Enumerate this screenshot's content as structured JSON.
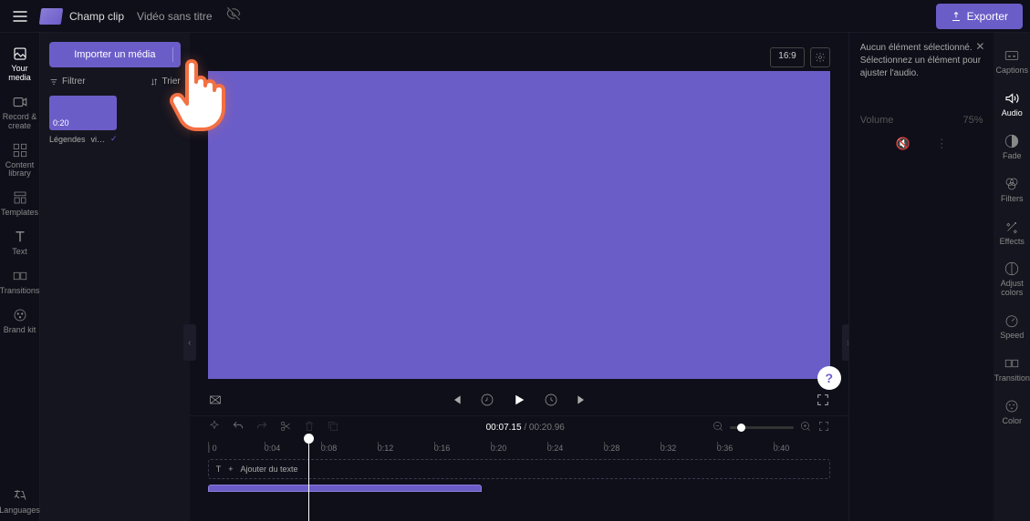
{
  "topbar": {
    "app_name": "Champ clip",
    "video_title": "Vidéo sans titre",
    "export_label": "Exporter"
  },
  "left_rail": {
    "items": [
      {
        "label": "Your media"
      },
      {
        "label": "Record & create"
      },
      {
        "label": "Content library"
      },
      {
        "label": "Templates"
      },
      {
        "label": "Text"
      },
      {
        "label": "Transitions"
      },
      {
        "label": "Brand kit"
      }
    ],
    "bottom": {
      "label": "Languages"
    }
  },
  "media_panel": {
    "import_label": "Importer un média",
    "filter_label": "Filtrer",
    "sort_label": "Trier",
    "thumb_duration": "0:20",
    "thumb_caption": "Légendes",
    "thumb_type": "vi…"
  },
  "preview": {
    "aspect": "16:9"
  },
  "playback": {
    "current_time": "00:07.15",
    "total_time": "00:20.96"
  },
  "ruler": [
    " | 0",
    "0:04",
    "0:08",
    "0:12",
    "0:16",
    "0:20",
    "0:24",
    "0:28",
    "0:32",
    "0:36",
    "0:40"
  ],
  "tracks": {
    "text_label": "Ajouter du texte"
  },
  "prop_panel": {
    "hint": "Aucun élément sélectionné. Sélectionnez un élément pour ajuster l'audio.",
    "volume_label": "Volume",
    "volume_value": "75%"
  },
  "right_rail": {
    "items": [
      {
        "label": "Captions"
      },
      {
        "label": "Audio"
      },
      {
        "label": "Fade"
      },
      {
        "label": "Filters"
      },
      {
        "label": "Effects"
      },
      {
        "label": "Adjust colors"
      },
      {
        "label": "Speed"
      },
      {
        "label": "Transition"
      },
      {
        "label": "Color"
      }
    ]
  }
}
